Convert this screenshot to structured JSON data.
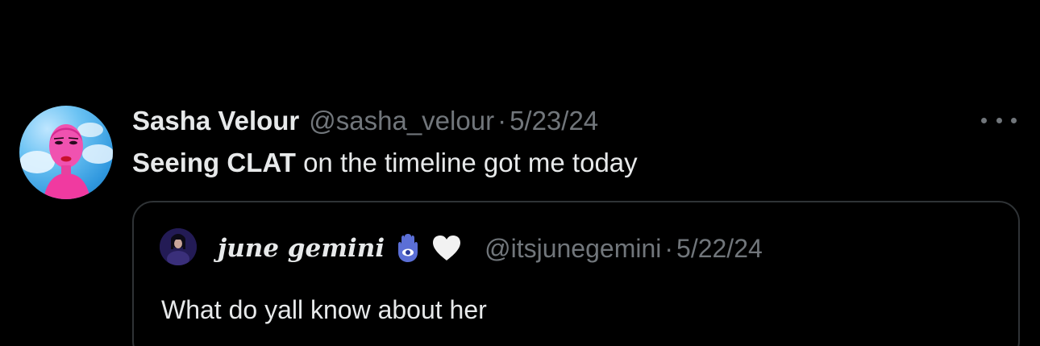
{
  "tweet": {
    "display_name": "Sasha Velour",
    "handle": "@sasha_velour",
    "separator": "·",
    "date": "5/23/24",
    "text_bold": "Seeing CLAT",
    "text_rest": " on the timeline got me today",
    "more_icon": "more-horizontal-icon"
  },
  "quote": {
    "display_name": "june gemini",
    "emojis": [
      "hamsa-icon",
      "white-heart-icon"
    ],
    "handle": "@itsjunegemini",
    "separator": "·",
    "date": "5/22/24",
    "text": "What do yall know about her"
  },
  "colors": {
    "background": "#000000",
    "primary_text": "#e7e9ea",
    "secondary_text": "#71767b",
    "border": "#2f3336",
    "hamsa": "#5b6fd6"
  }
}
